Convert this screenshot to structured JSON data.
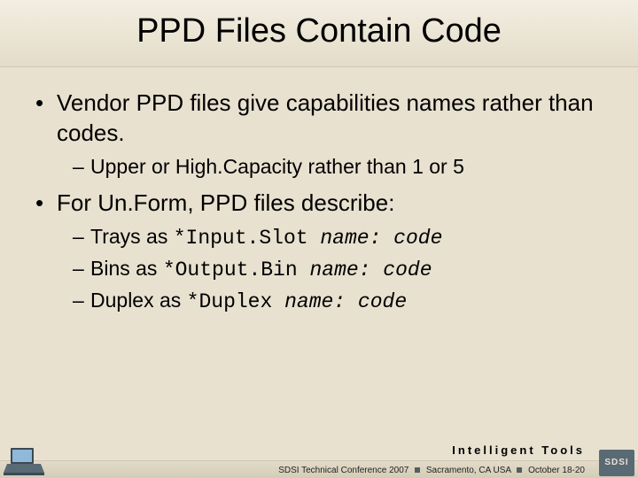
{
  "title": "PPD Files Contain Code",
  "bullets": [
    {
      "text": "Vendor PPD files give capabilities names rather than codes.",
      "sub": [
        {
          "prefix": "Upper or High.Capacity rather than 1 or 5"
        }
      ]
    },
    {
      "text": "For Un.Form, PPD files describe:",
      "sub": [
        {
          "prefix": "Trays as ",
          "code": "*Input.Slot ",
          "ital": "name: code"
        },
        {
          "prefix": "Bins as ",
          "code": "*Output.Bin ",
          "ital": "name: code"
        },
        {
          "prefix": "Duplex as ",
          "code": "*Duplex ",
          "ital": "name: code"
        }
      ]
    }
  ],
  "footer": {
    "tagline": "Intelligent Tools",
    "conf": "SDSI Technical Conference 2007",
    "loc": "Sacramento, CA  USA",
    "date": "October 18-20",
    "badge": "SDSI"
  }
}
